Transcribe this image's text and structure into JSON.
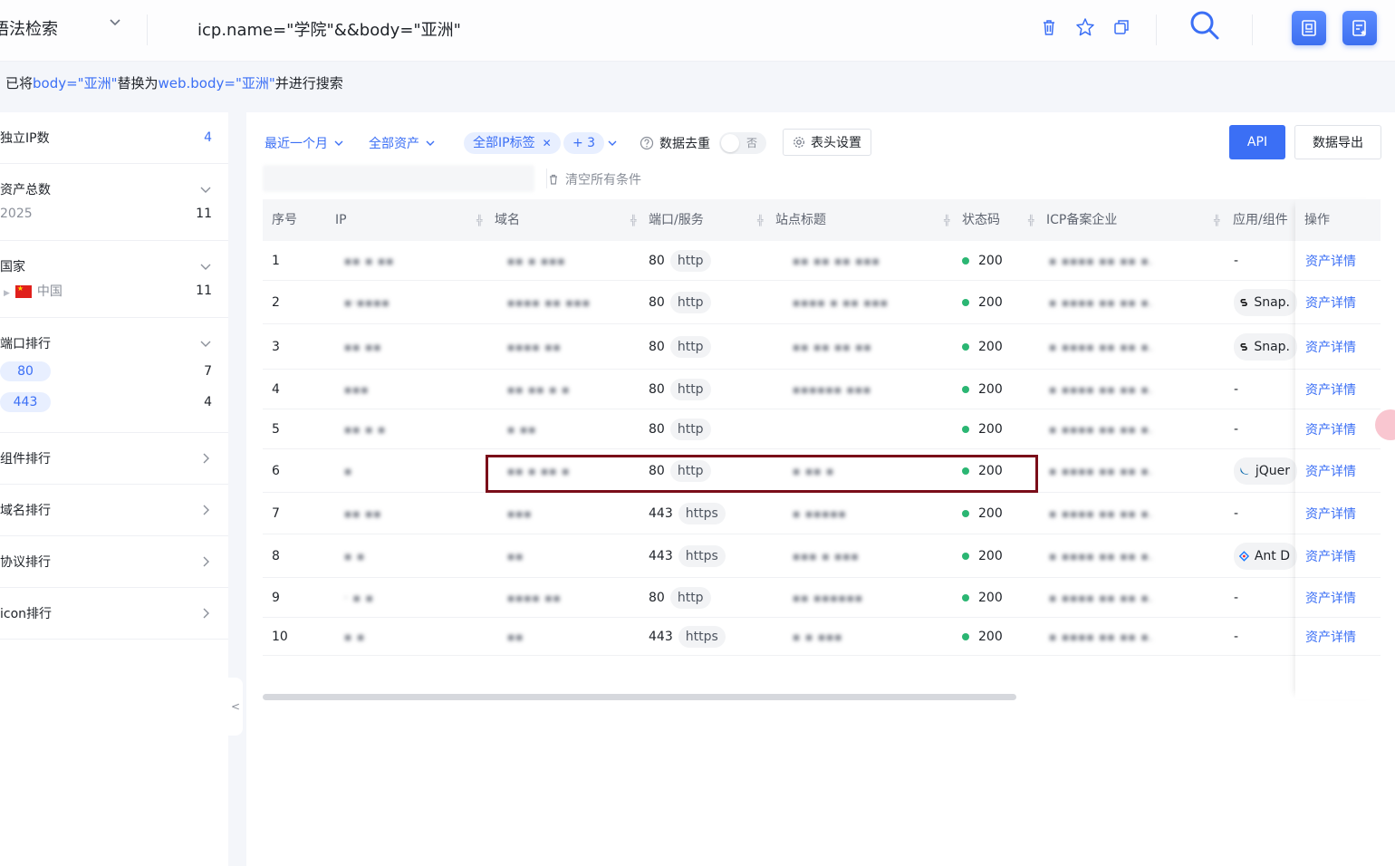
{
  "search": {
    "mode_label": "语法检索",
    "query": "icp.name=\"学院\"&&body=\"亚洲\""
  },
  "notice": {
    "prefix": "已将",
    "from": "body=\"亚洲\"",
    "mid": "替换为",
    "to": "web.body=\"亚洲\"",
    "suffix": "并进行搜索"
  },
  "sidebar": {
    "unique_ip": {
      "label": "独立IP数",
      "count": "4"
    },
    "asset_total": {
      "label": "资产总数",
      "rows": [
        {
          "label": "2025",
          "value": "11"
        }
      ]
    },
    "country": {
      "label": "国家",
      "rows": [
        {
          "label": "中国",
          "value": "11"
        }
      ]
    },
    "port_rank": {
      "label": "端口排行",
      "rows": [
        {
          "label": "80",
          "value": "7"
        },
        {
          "label": "443",
          "value": "4"
        }
      ]
    },
    "collapsed": [
      "组件排行",
      "域名排行",
      "协议排行",
      "icon排行"
    ],
    "collapse_glyph": "<"
  },
  "filters": {
    "time": "最近一个月",
    "assets": "全部资产",
    "ip_tag": "全部IP标签",
    "plus": "+ 3",
    "dedupe": "数据去重",
    "switch_off": "否",
    "header_settings": "表头设置",
    "api": "API",
    "export": "数据导出",
    "clear_all": "清空所有条件"
  },
  "table": {
    "columns": [
      "序号",
      "IP",
      "域名",
      "端口/服务",
      "站点标题",
      "状态码",
      "ICP备案企业",
      "应用/组件",
      "操作"
    ],
    "action_label": "资产详情",
    "rows": [
      {
        "no": "1",
        "port": "80",
        "service": "http",
        "status": "200",
        "app": "-"
      },
      {
        "no": "2",
        "port": "80",
        "service": "http",
        "status": "200",
        "app": "Snap."
      },
      {
        "no": "3",
        "port": "80",
        "service": "http",
        "status": "200",
        "app": "Snap."
      },
      {
        "no": "4",
        "port": "80",
        "service": "http",
        "status": "200",
        "app": "-"
      },
      {
        "no": "5",
        "port": "80",
        "service": "http",
        "status": "200",
        "app": "-"
      },
      {
        "no": "6",
        "port": "80",
        "service": "http",
        "status": "200",
        "app": "jQuer"
      },
      {
        "no": "7",
        "port": "443",
        "service": "https",
        "status": "200",
        "app": "-"
      },
      {
        "no": "8",
        "port": "443",
        "service": "https",
        "status": "200",
        "app": "Ant D"
      },
      {
        "no": "9",
        "port": "80",
        "service": "http",
        "status": "200",
        "app": "-"
      },
      {
        "no": "10",
        "port": "443",
        "service": "https",
        "status": "200",
        "app": "-"
      }
    ]
  },
  "colors": {
    "accent": "#3b6ff5",
    "status_ok": "#2bb673",
    "highlight_box": "#7a0d19"
  },
  "icons": [
    "chevron-down-icon",
    "trash-icon",
    "star-icon",
    "copy-icon",
    "search-icon",
    "tool-a-icon",
    "tool-b-icon",
    "help-icon",
    "gear-icon",
    "clear-icon",
    "snapdragon-icon",
    "jquery-icon",
    "antd-icon",
    "flag-cn-icon"
  ]
}
